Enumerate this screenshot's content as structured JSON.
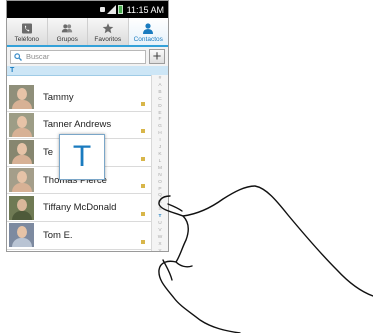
{
  "statusbar": {
    "time": "11:15 AM"
  },
  "tabs": [
    {
      "label": "Teléfono",
      "icon": "phone-icon",
      "active": false
    },
    {
      "label": "Grupos",
      "icon": "groups-icon",
      "active": false
    },
    {
      "label": "Favoritos",
      "icon": "star-icon",
      "active": false
    },
    {
      "label": "Contactos",
      "icon": "contact-icon",
      "active": true
    }
  ],
  "search": {
    "placeholder": "Buscar",
    "add_label": "+"
  },
  "section_header": "T",
  "contacts": [
    {
      "name": "Tammy"
    },
    {
      "name": "Tanner Andrews"
    },
    {
      "name": "Te"
    },
    {
      "name": "Thomas Pierce"
    },
    {
      "name": "Tiffany  McDonald"
    },
    {
      "name": "Tom E."
    }
  ],
  "index_letters": [
    "#",
    "A",
    "B",
    "C",
    "D",
    "E",
    "F",
    "G",
    "H",
    "I",
    "J",
    "K",
    "L",
    "M",
    "N",
    "O",
    "P",
    "Q",
    "R",
    "S",
    "T",
    "U",
    "V",
    "W",
    "X",
    "Y",
    "Z"
  ],
  "popup_letter": "T",
  "colors": {
    "accent": "#33a1d9",
    "index_highlight": "#1a7bbf"
  }
}
